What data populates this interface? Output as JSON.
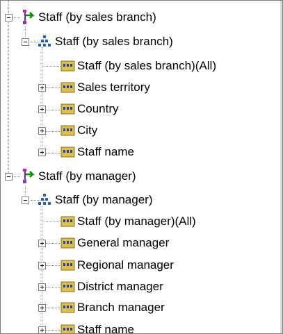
{
  "tree": {
    "dimensions": [
      {
        "label": "Staff (by sales branch)",
        "icon": "dimension-icon",
        "expanded": true,
        "hierarchy": {
          "label": "Staff (by sales branch)",
          "icon": "hierarchy-icon",
          "expanded": true,
          "levels": [
            {
              "label": "Staff (by sales branch)(All)",
              "icon": "level-icon",
              "has_toggle": false
            },
            {
              "label": "Sales territory",
              "icon": "level-icon",
              "has_toggle": true
            },
            {
              "label": "Country",
              "icon": "level-icon",
              "has_toggle": true
            },
            {
              "label": "City",
              "icon": "level-icon",
              "has_toggle": true
            },
            {
              "label": "Staff name",
              "icon": "level-icon",
              "has_toggle": true
            }
          ]
        }
      },
      {
        "label": "Staff (by manager)",
        "icon": "dimension-icon",
        "expanded": true,
        "hierarchy": {
          "label": "Staff (by manager)",
          "icon": "hierarchy-icon",
          "expanded": true,
          "levels": [
            {
              "label": "Staff (by manager)(All)",
              "icon": "level-icon",
              "has_toggle": false
            },
            {
              "label": "General manager",
              "icon": "level-icon",
              "has_toggle": true
            },
            {
              "label": "Regional manager",
              "icon": "level-icon",
              "has_toggle": true
            },
            {
              "label": "District manager",
              "icon": "level-icon",
              "has_toggle": true
            },
            {
              "label": "Branch manager",
              "icon": "level-icon",
              "has_toggle": true
            },
            {
              "label": "Staff name",
              "icon": "level-icon",
              "has_toggle": true
            }
          ]
        }
      }
    ]
  }
}
